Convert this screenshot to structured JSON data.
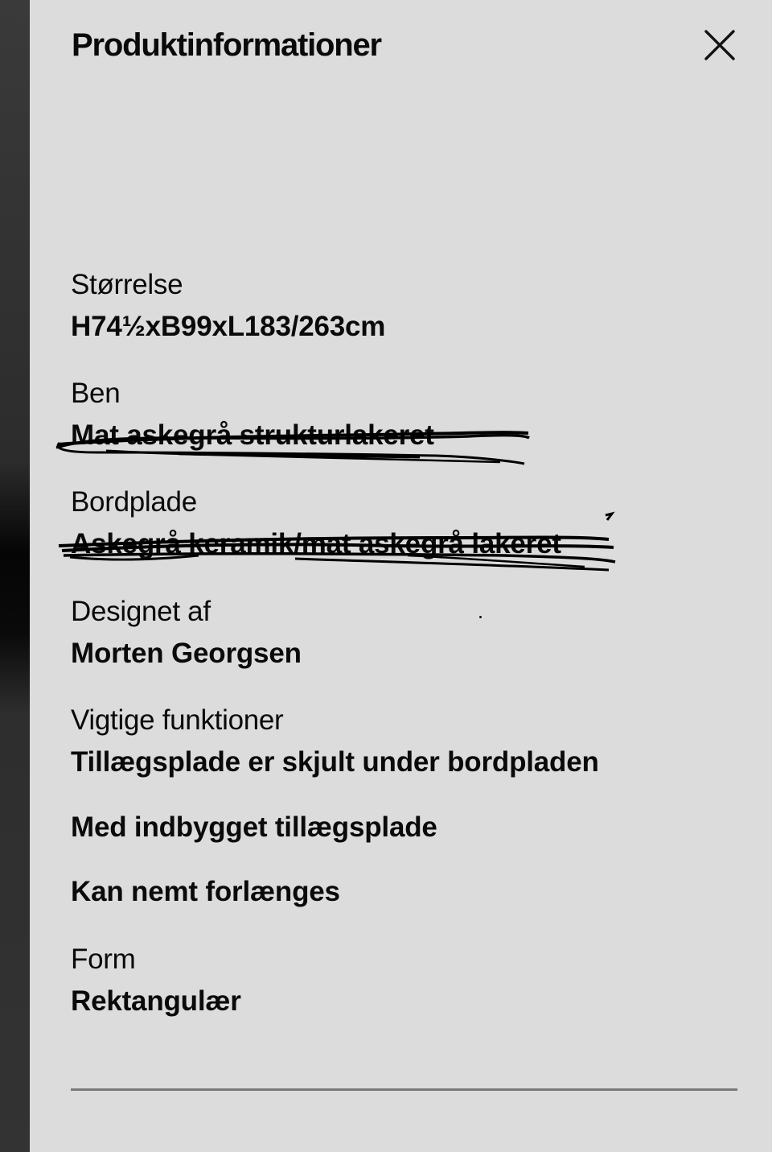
{
  "header": {
    "title": "Produktinformationer",
    "close_icon": "close-icon"
  },
  "details": {
    "size_label": "Størrelse",
    "size_value": "H74½xB99xL183/263cm",
    "legs_label": "Ben",
    "legs_value": "Mat askegrå strukturlakeret",
    "top_label": "Bordplade",
    "top_value": "Askegrå keramik/mat askegrå lakeret",
    "designer_label": "Designet af",
    "designer_value": "Morten Georgsen",
    "features_label": "Vigtige funktioner",
    "features": [
      "Tillægsplade er skjult under bordpladen",
      "Med indbygget tillægsplade",
      "Kan nemt forlænges"
    ],
    "shape_label": "Form",
    "shape_value": "Rektangulær"
  }
}
